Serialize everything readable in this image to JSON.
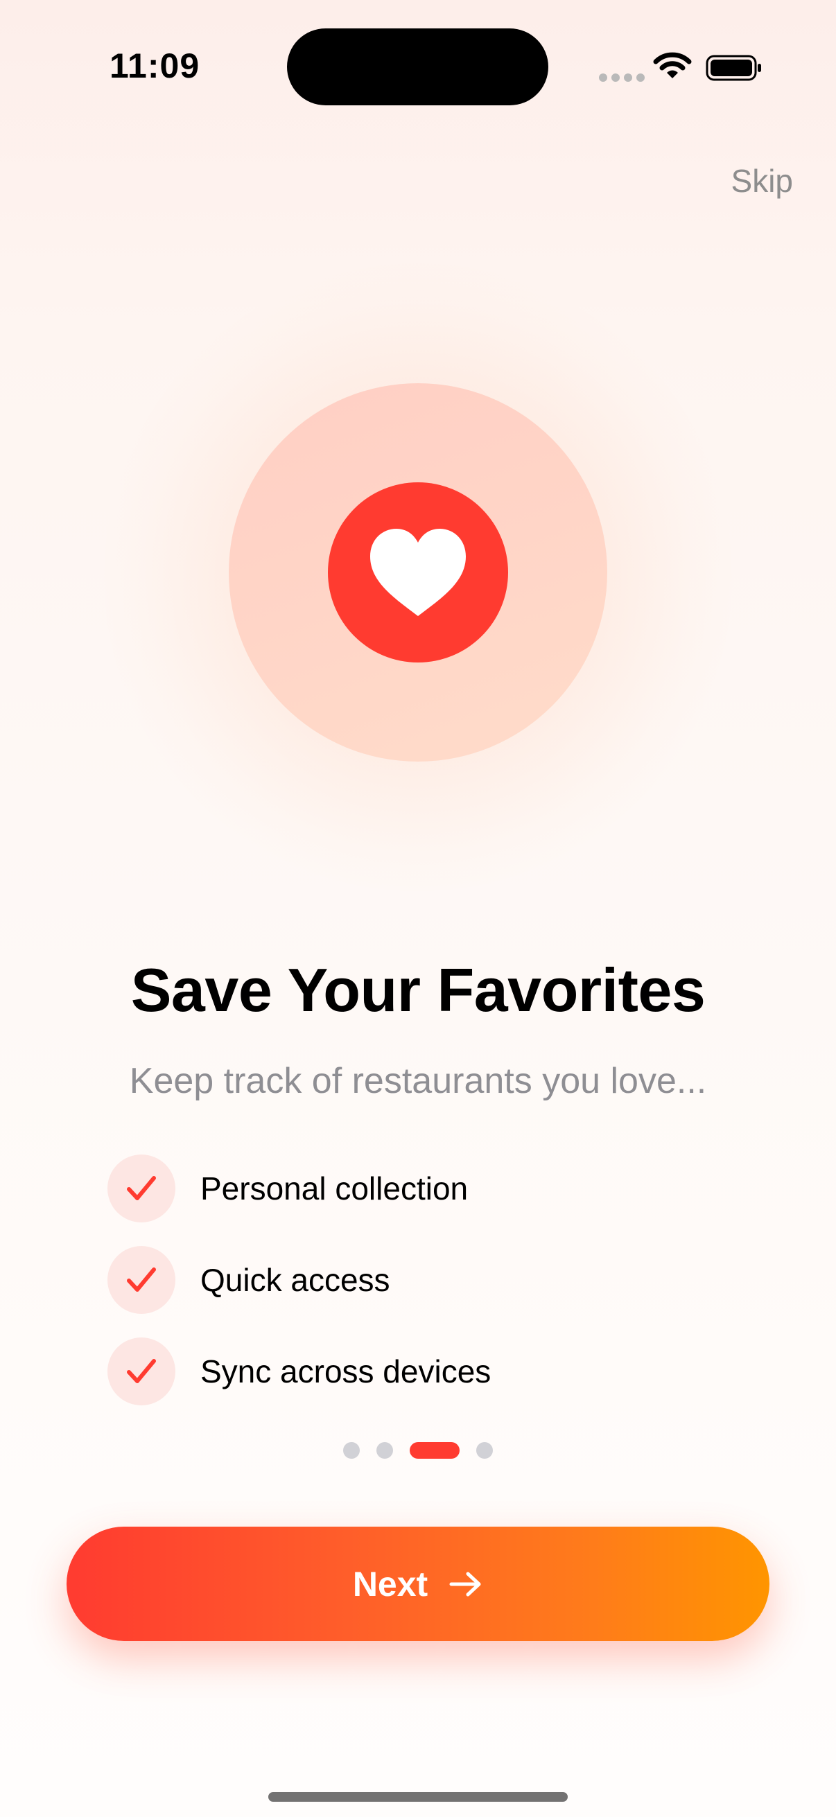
{
  "status_bar": {
    "time": "11:09",
    "signal_icon": "cellular-dots-icon",
    "wifi_icon": "wifi-icon",
    "battery_icon": "battery-icon"
  },
  "header": {
    "skip_label": "Skip"
  },
  "hero": {
    "icon": "heart-icon",
    "accent_color": "#FF3B30"
  },
  "content": {
    "title": "Save Your Favorites",
    "subtitle": "Keep track of restaurants you love...",
    "features": [
      {
        "label": "Personal collection",
        "icon": "checkmark-icon"
      },
      {
        "label": "Quick access",
        "icon": "checkmark-icon"
      },
      {
        "label": "Sync across devices",
        "icon": "checkmark-icon"
      }
    ]
  },
  "pagination": {
    "total_pages": 4,
    "current_page": 3
  },
  "footer": {
    "next_label": "Next",
    "next_icon": "arrow-right-icon",
    "gradient_start": "#FF3B30",
    "gradient_end": "#FF9500"
  }
}
